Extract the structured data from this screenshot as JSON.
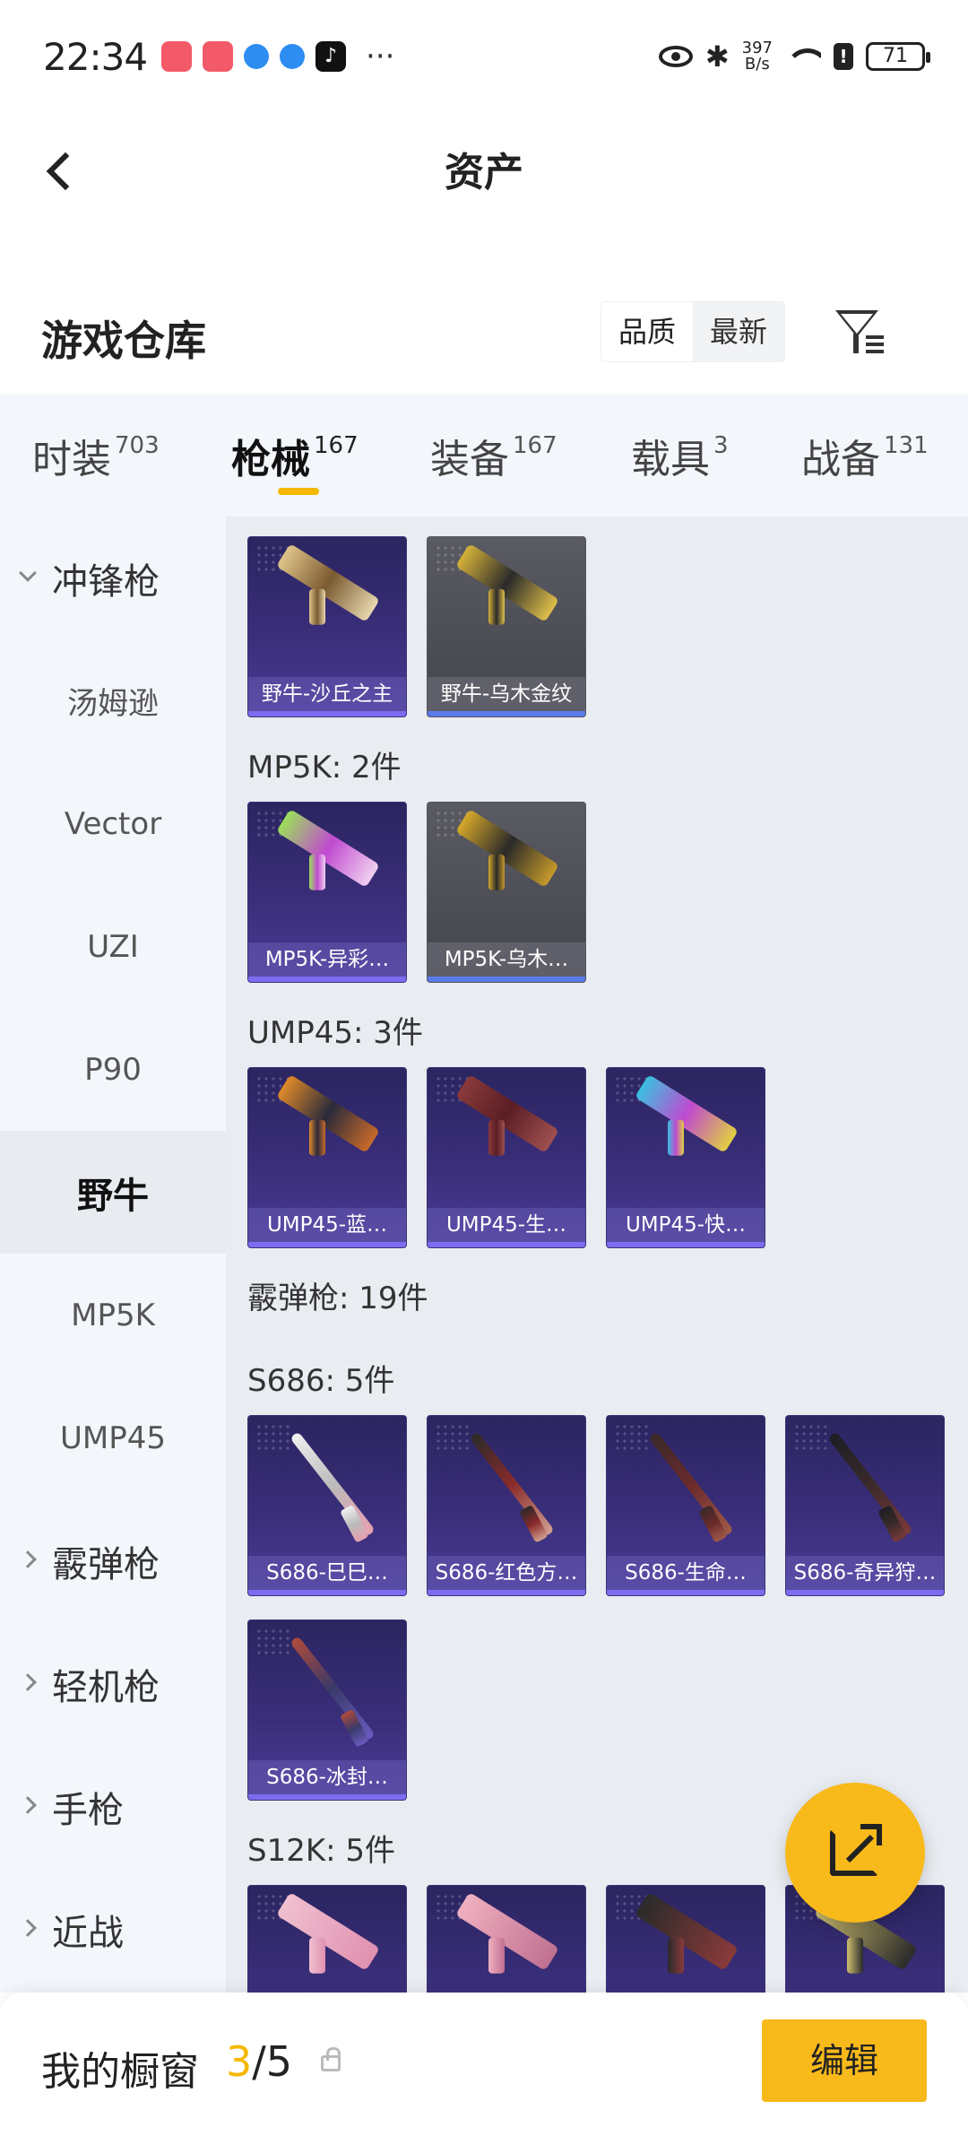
{
  "status_bar": {
    "time": "22:34",
    "speed_top": "397",
    "speed_bottom": "B/s",
    "battery": "71",
    "alert": "!",
    "more": "···",
    "bluetooth": "✱",
    "tiktok": "♪"
  },
  "header": {
    "title": "资产"
  },
  "warehouse": {
    "title": "游戏仓库",
    "sort_options": [
      "品质",
      "最新"
    ]
  },
  "tabs": [
    {
      "label": "时装",
      "count": "703"
    },
    {
      "label": "枪械",
      "count": "167"
    },
    {
      "label": "装备",
      "count": "167"
    },
    {
      "label": "载具",
      "count": "3"
    },
    {
      "label": "战备",
      "count": "131"
    }
  ],
  "sidebar": [
    {
      "label": "冲锋枪",
      "type": "group",
      "open": true
    },
    {
      "label": "汤姆逊"
    },
    {
      "label": "Vector"
    },
    {
      "label": "UZI"
    },
    {
      "label": "P90"
    },
    {
      "label": "野牛",
      "selected": true
    },
    {
      "label": "MP5K"
    },
    {
      "label": "UMP45"
    },
    {
      "label": "霰弹枪",
      "type": "group"
    },
    {
      "label": "轻机枪",
      "type": "group"
    },
    {
      "label": "手枪",
      "type": "group"
    },
    {
      "label": "近战",
      "type": "group"
    }
  ],
  "sections": {
    "mp5k": "MP5K: 2件",
    "ump45": "UMP45: 3件",
    "shotgun": "霰弹枪: 19件",
    "s686": "S686: 5件",
    "s12k": "S12K: 5件"
  },
  "items": {
    "bison": [
      "野牛-沙丘之主",
      "野牛-乌木金纹"
    ],
    "mp5k": [
      "MP5K-异彩…",
      "MP5K-乌木…"
    ],
    "ump45": [
      "UMP45-蓝…",
      "UMP45-生…",
      "UMP45-快…"
    ],
    "s686": [
      "S686-巳巳…",
      "S686-红色方…",
      "S686-生命…",
      "S686-奇异狩…",
      "S686-冰封…"
    ]
  },
  "bottom_bar": {
    "title": "我的橱窗",
    "count_current": "3",
    "count_total": "/5",
    "edit_label": "编辑"
  },
  "colors": {
    "accent": "#f8b91a",
    "card_purple": "#3a2e7a",
    "card_gray": "#4d4d55"
  }
}
